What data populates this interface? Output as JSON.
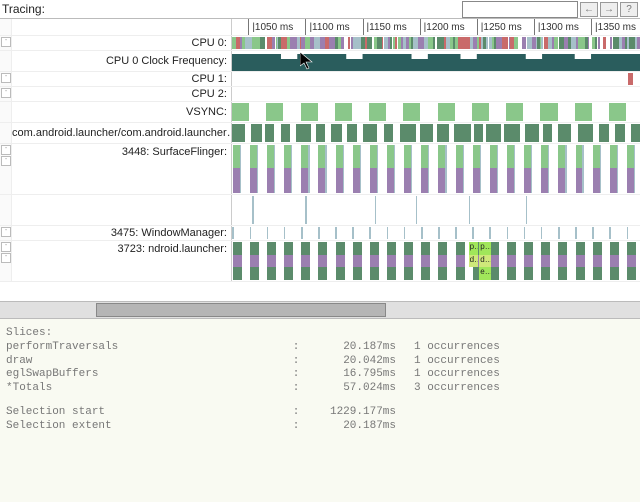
{
  "topbar": {
    "title": "Tracing:",
    "search_value": "",
    "prev": "←",
    "next": "→",
    "help": "?"
  },
  "ruler": {
    "ticks": [
      {
        "pos_pct": 4,
        "label": "1050 ms"
      },
      {
        "pos_pct": 18,
        "label": "1100 ms"
      },
      {
        "pos_pct": 32,
        "label": "1150 ms"
      },
      {
        "pos_pct": 46,
        "label": "1200 ms"
      },
      {
        "pos_pct": 60,
        "label": "1250 ms"
      },
      {
        "pos_pct": 74,
        "label": "1300 ms"
      },
      {
        "pos_pct": 88,
        "label": "1350 ms"
      }
    ]
  },
  "rows": {
    "cpu0": "CPU 0:",
    "cpu0freq": "CPU 0 Clock Frequency:",
    "cpu1": "CPU 1:",
    "cpu2": "CPU 2:",
    "vsync": "VSYNC:",
    "launcher_surface": "com.android.launcher/com.android.launcher…",
    "surfaceflinger": "3448: SurfaceFlinger:",
    "windowmgr": "3475: WindowManager:",
    "ndroid": "3723: ndroid.launcher:"
  },
  "selection_labels": {
    "a": "p…",
    "b": "per…",
    "c": "draw",
    "d": "draw",
    "e": "egl…"
  },
  "slices": {
    "header": "Slices:",
    "items": [
      {
        "name": " performTraversals",
        "time": "20.187ms",
        "occ": "1 occurrences"
      },
      {
        "name": " draw",
        "time": "20.042ms",
        "occ": "1 occurrences"
      },
      {
        "name": " eglSwapBuffers",
        "time": "16.795ms",
        "occ": "1 occurrences"
      },
      {
        "name": "*Totals",
        "time": "57.024ms",
        "occ": "3 occurrences"
      }
    ],
    "sel_start_label": "Selection start",
    "sel_start_value": "1229.177ms",
    "sel_extent_label": "Selection extent",
    "sel_extent_value": "20.187ms"
  },
  "chart_data": {
    "type": "area",
    "series": "CPU 0 Clock Frequency",
    "x_range_ms": [
      1020,
      1380
    ],
    "approx_levels_pct": [
      85,
      85,
      85,
      60,
      85,
      85,
      85,
      60,
      85,
      85,
      85,
      60,
      85,
      85,
      60,
      85,
      85,
      85,
      60,
      85,
      85,
      60,
      85,
      85,
      85
    ],
    "note": "Step-area; high≈85% track height, dips≈60%"
  }
}
